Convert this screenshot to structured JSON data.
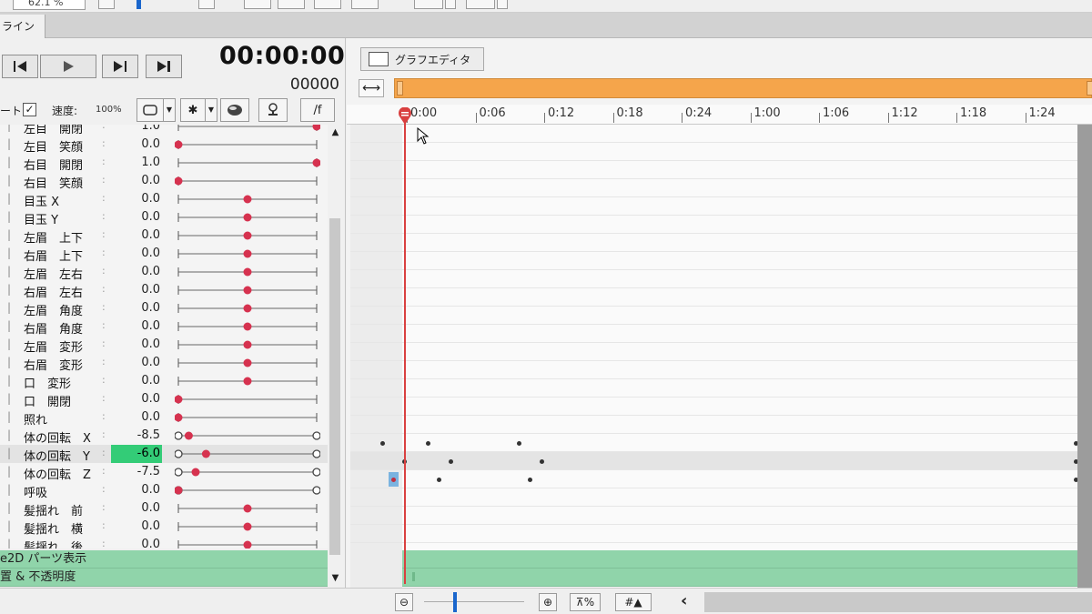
{
  "toolbar": {
    "zoom_value": "62.1 %"
  },
  "tabs": {
    "timeline_label": "ライン"
  },
  "playback": {
    "time": "00:00:00",
    "frame": "00000"
  },
  "controls": {
    "auto_label": "ート",
    "auto_checked": "✓",
    "speed_label": "速度:",
    "speed_value": "100%",
    "fps_label": "/f"
  },
  "params": [
    {
      "name": "左目　開閉",
      "value": "1.0",
      "knob": 1.0,
      "hollow": false
    },
    {
      "name": "左目　笑顔",
      "value": "0.0",
      "knob": 0.0,
      "hollow": false
    },
    {
      "name": "右目　開閉",
      "value": "1.0",
      "knob": 1.0,
      "hollow": false
    },
    {
      "name": "右目　笑顔",
      "value": "0.0",
      "knob": 0.0,
      "hollow": false
    },
    {
      "name": "目玉 X",
      "value": "0.0",
      "knob": 0.5,
      "hollow": false
    },
    {
      "name": "目玉 Y",
      "value": "0.0",
      "knob": 0.5,
      "hollow": false
    },
    {
      "name": "左眉　上下",
      "value": "0.0",
      "knob": 0.5,
      "hollow": false
    },
    {
      "name": "右眉　上下",
      "value": "0.0",
      "knob": 0.5,
      "hollow": false
    },
    {
      "name": "左眉　左右",
      "value": "0.0",
      "knob": 0.5,
      "hollow": false
    },
    {
      "name": "右眉　左右",
      "value": "0.0",
      "knob": 0.5,
      "hollow": false
    },
    {
      "name": "左眉　角度",
      "value": "0.0",
      "knob": 0.5,
      "hollow": false
    },
    {
      "name": "右眉　角度",
      "value": "0.0",
      "knob": 0.5,
      "hollow": false
    },
    {
      "name": "左眉　変形",
      "value": "0.0",
      "knob": 0.5,
      "hollow": false
    },
    {
      "name": "右眉　変形",
      "value": "0.0",
      "knob": 0.5,
      "hollow": false
    },
    {
      "name": "口　変形",
      "value": "0.0",
      "knob": 0.5,
      "hollow": false
    },
    {
      "name": "口　開閉",
      "value": "0.0",
      "knob": 0.0,
      "hollow": false
    },
    {
      "name": "照れ",
      "value": "0.0",
      "knob": 0.0,
      "hollow": false
    },
    {
      "name": "体の回転　X",
      "value": "-8.5",
      "knob": 0.075,
      "hollow": true
    },
    {
      "name": "体の回転　Y",
      "value": "-6.0",
      "knob": 0.2,
      "hollow": true,
      "selected": true
    },
    {
      "name": "体の回転　Z",
      "value": "-7.5",
      "knob": 0.125,
      "hollow": true
    },
    {
      "name": "呼吸",
      "value": "0.0",
      "knob": 0.0,
      "hollow": true
    },
    {
      "name": "髪揺れ　前",
      "value": "0.0",
      "knob": 0.5,
      "hollow": false
    },
    {
      "name": "髪揺れ　横",
      "value": "0.0",
      "knob": 0.5,
      "hollow": false
    },
    {
      "name": "髪揺れ　後",
      "value": "0.0",
      "knob": 0.5,
      "hollow": false
    }
  ],
  "sections": [
    {
      "label": "e2D パーツ表示"
    },
    {
      "label": "置 & 不透明度"
    }
  ],
  "graph_editor": {
    "label": "グラフエディタ"
  },
  "ruler": {
    "labels": [
      "0:00",
      "0:06",
      "0:12",
      "0:18",
      "0:24",
      "1:00",
      "1:06",
      "1:12",
      "1:18",
      "1:24"
    ]
  },
  "tracks": {
    "body_x_keyframes": [
      0,
      1,
      2,
      3
    ],
    "body_y_keyframes": [
      0,
      1,
      2,
      3
    ],
    "body_z_keyframes": [
      0,
      1,
      2,
      3
    ]
  },
  "colors": {
    "accent_orange": "#f5a54b",
    "section_green": "#90d4aa",
    "value_highlight": "#33cc77",
    "knob_red": "#d6324f",
    "playhead": "#d94040"
  }
}
